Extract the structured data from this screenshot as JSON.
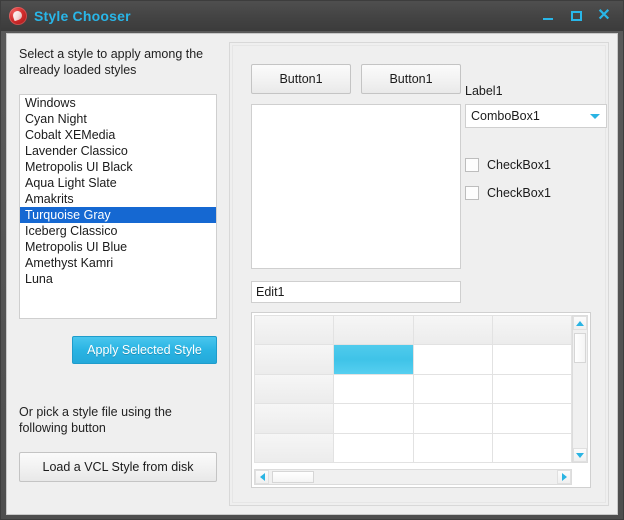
{
  "window": {
    "title": "Style Chooser",
    "icon": "app-globe-icon",
    "controls": {
      "minimize": "minimize-icon",
      "maximize": "maximize-icon",
      "close": "close-icon"
    }
  },
  "colors": {
    "accent": "#2ab4e3",
    "title_text": "#29b6e8",
    "titlebar_bg": "#434343",
    "client_bg": "#efefef",
    "selection_blue": "#1568d2",
    "grid_selected_cell": "#46c7ea",
    "app_icon_red": "#d22c2c"
  },
  "left_pane": {
    "caption": "Select a style to apply among the already loaded styles",
    "styles": [
      "Windows",
      "Cyan Night",
      "Cobalt XEMedia",
      "Lavender Classico",
      "Metropolis UI Black",
      "Aqua Light Slate",
      "Amakrits",
      "Turquoise Gray",
      "Iceberg Classico",
      "Metropolis UI Blue",
      "Amethyst Kamri",
      "Luna"
    ],
    "selected_style": "Turquoise Gray",
    "selected_index": 7,
    "apply_button_label": "Apply Selected Style",
    "load_caption": "Or pick a style file using the following button",
    "load_button_label": "Load a VCL Style from disk"
  },
  "preview_pane": {
    "button_a_label": "Button1",
    "button_b_label": "Button1",
    "memo_value": "",
    "edit_label": "Edit1",
    "label1": "Label1",
    "combobox": {
      "value": "ComboBox1",
      "arrow_icon": "chevron-down-icon"
    },
    "checkboxes": [
      {
        "label": "CheckBox1",
        "checked": false
      },
      {
        "label": "CheckBox1",
        "checked": false
      }
    ],
    "grid": {
      "rows": 5,
      "columns": 4,
      "selected_cell": {
        "row": 1,
        "col": 1
      },
      "cells": [
        [
          "",
          "",
          "",
          ""
        ],
        [
          "",
          "",
          "",
          ""
        ],
        [
          "",
          "",
          "",
          ""
        ],
        [
          "",
          "",
          "",
          ""
        ],
        [
          "",
          "",
          "",
          ""
        ]
      ],
      "scrollbars": {
        "vertical": {
          "up_icon": "triangle-up-icon",
          "down_icon": "triangle-down-icon"
        },
        "horizontal": {
          "left_icon": "triangle-left-icon",
          "right_icon": "triangle-right-icon"
        }
      }
    }
  }
}
